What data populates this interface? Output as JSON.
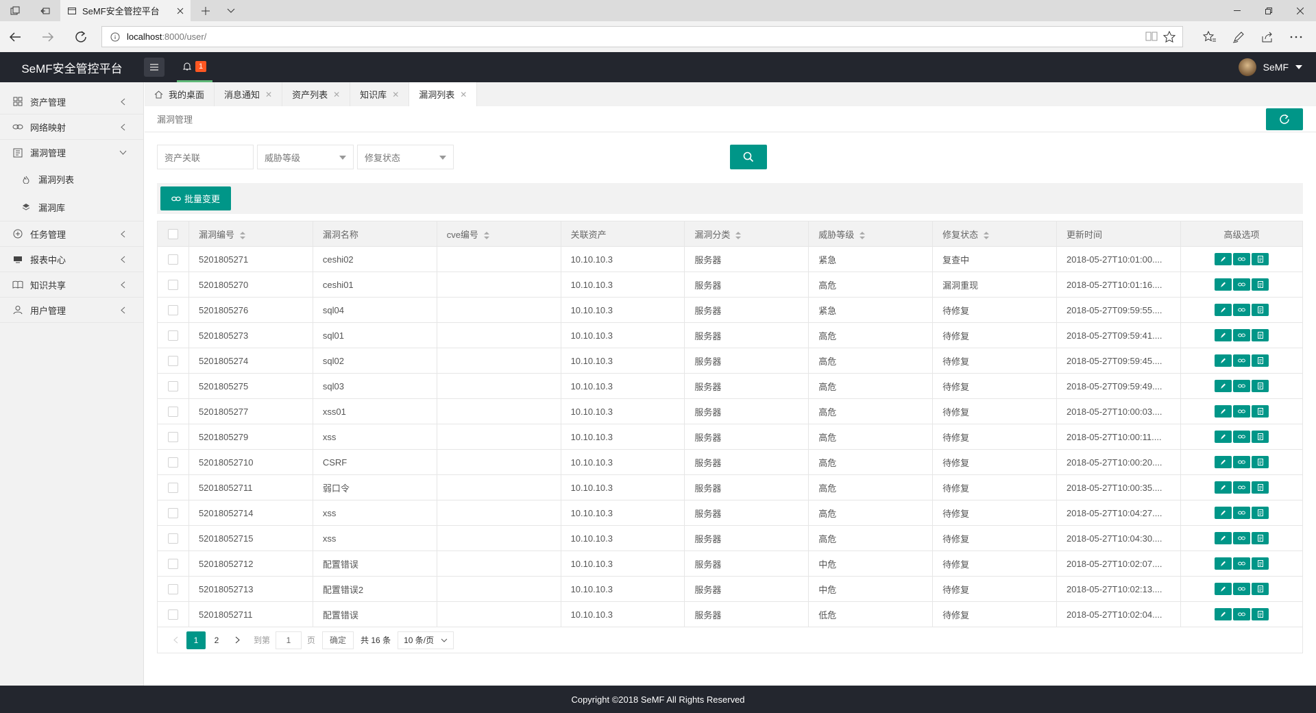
{
  "browser": {
    "tab_title": "SeMF安全管控平台",
    "url_host": "localhost",
    "url_rest": ":8000/user/"
  },
  "header": {
    "logo": "SeMF安全管控平台",
    "notify_count": "1",
    "user_name": "SeMF"
  },
  "sidebar": {
    "items": [
      {
        "label": "资产管理",
        "icon": "asset-icon"
      },
      {
        "label": "网络映射",
        "icon": "link-icon"
      },
      {
        "label": "漏洞管理",
        "icon": "vuln-icon"
      },
      {
        "label": "漏洞列表",
        "icon": "fire-icon"
      },
      {
        "label": "漏洞库",
        "icon": "stack-icon"
      },
      {
        "label": "任务管理",
        "icon": "task-icon"
      },
      {
        "label": "报表中心",
        "icon": "report-icon"
      },
      {
        "label": "知识共享",
        "icon": "book-icon"
      },
      {
        "label": "用户管理",
        "icon": "user-icon"
      }
    ]
  },
  "tabs": [
    {
      "label": "我的桌面"
    },
    {
      "label": "消息通知"
    },
    {
      "label": "资产列表"
    },
    {
      "label": "知识库"
    },
    {
      "label": "漏洞列表"
    }
  ],
  "breadcrumb": "漏洞管理",
  "filters": {
    "asset_placeholder": "资产关联",
    "level_placeholder": "威胁等级",
    "status_placeholder": "修复状态"
  },
  "toolbar": {
    "batch_label": "批量变更"
  },
  "table": {
    "headers": [
      "漏洞编号",
      "漏洞名称",
      "cve编号",
      "关联资产",
      "漏洞分类",
      "威胁等级",
      "修复状态",
      "更新时间",
      "高级选项"
    ],
    "rows": [
      {
        "id": "5201805271",
        "name": "ceshi02",
        "cve": "",
        "asset": "10.10.10.3",
        "cat": "服务器",
        "level": "紧急",
        "status": "复查中",
        "time": "2018-05-27T10:01:00...."
      },
      {
        "id": "5201805270",
        "name": "ceshi01",
        "cve": "",
        "asset": "10.10.10.3",
        "cat": "服务器",
        "level": "高危",
        "status": "漏洞重现",
        "time": "2018-05-27T10:01:16...."
      },
      {
        "id": "5201805276",
        "name": "sql04",
        "cve": "",
        "asset": "10.10.10.3",
        "cat": "服务器",
        "level": "紧急",
        "status": "待修复",
        "time": "2018-05-27T09:59:55...."
      },
      {
        "id": "5201805273",
        "name": "sql01",
        "cve": "",
        "asset": "10.10.10.3",
        "cat": "服务器",
        "level": "高危",
        "status": "待修复",
        "time": "2018-05-27T09:59:41...."
      },
      {
        "id": "5201805274",
        "name": "sql02",
        "cve": "",
        "asset": "10.10.10.3",
        "cat": "服务器",
        "level": "高危",
        "status": "待修复",
        "time": "2018-05-27T09:59:45...."
      },
      {
        "id": "5201805275",
        "name": "sql03",
        "cve": "",
        "asset": "10.10.10.3",
        "cat": "服务器",
        "level": "高危",
        "status": "待修复",
        "time": "2018-05-27T09:59:49...."
      },
      {
        "id": "5201805277",
        "name": "xss01",
        "cve": "",
        "asset": "10.10.10.3",
        "cat": "服务器",
        "level": "高危",
        "status": "待修复",
        "time": "2018-05-27T10:00:03...."
      },
      {
        "id": "5201805279",
        "name": "xss",
        "cve": "",
        "asset": "10.10.10.3",
        "cat": "服务器",
        "level": "高危",
        "status": "待修复",
        "time": "2018-05-27T10:00:11...."
      },
      {
        "id": "52018052710",
        "name": "CSRF",
        "cve": "",
        "asset": "10.10.10.3",
        "cat": "服务器",
        "level": "高危",
        "status": "待修复",
        "time": "2018-05-27T10:00:20...."
      },
      {
        "id": "52018052711",
        "name": "弱口令",
        "cve": "",
        "asset": "10.10.10.3",
        "cat": "服务器",
        "level": "高危",
        "status": "待修复",
        "time": "2018-05-27T10:00:35...."
      },
      {
        "id": "52018052714",
        "name": "xss",
        "cve": "",
        "asset": "10.10.10.3",
        "cat": "服务器",
        "level": "高危",
        "status": "待修复",
        "time": "2018-05-27T10:04:27...."
      },
      {
        "id": "52018052715",
        "name": "xss",
        "cve": "",
        "asset": "10.10.10.3",
        "cat": "服务器",
        "level": "高危",
        "status": "待修复",
        "time": "2018-05-27T10:04:30...."
      },
      {
        "id": "52018052712",
        "name": "配置错误",
        "cve": "",
        "asset": "10.10.10.3",
        "cat": "服务器",
        "level": "中危",
        "status": "待修复",
        "time": "2018-05-27T10:02:07...."
      },
      {
        "id": "52018052713",
        "name": "配置错误2",
        "cve": "",
        "asset": "10.10.10.3",
        "cat": "服务器",
        "level": "中危",
        "status": "待修复",
        "time": "2018-05-27T10:02:13...."
      },
      {
        "id": "52018052711",
        "name": "配置错误",
        "cve": "",
        "asset": "10.10.10.3",
        "cat": "服务器",
        "level": "低危",
        "status": "待修复",
        "time": "2018-05-27T10:02:04...."
      }
    ]
  },
  "pager": {
    "page1": "1",
    "page2": "2",
    "goto_label": "到第",
    "goto_value": "1",
    "page_unit": "页",
    "confirm": "确定",
    "total": "共 16 条",
    "per_page": "10 条/页"
  },
  "footer": "Copyright ©2018 SeMF All Rights Reserved",
  "colors": {
    "accent": "#009688",
    "header_bg": "#23262e",
    "badge": "#ff5722"
  }
}
